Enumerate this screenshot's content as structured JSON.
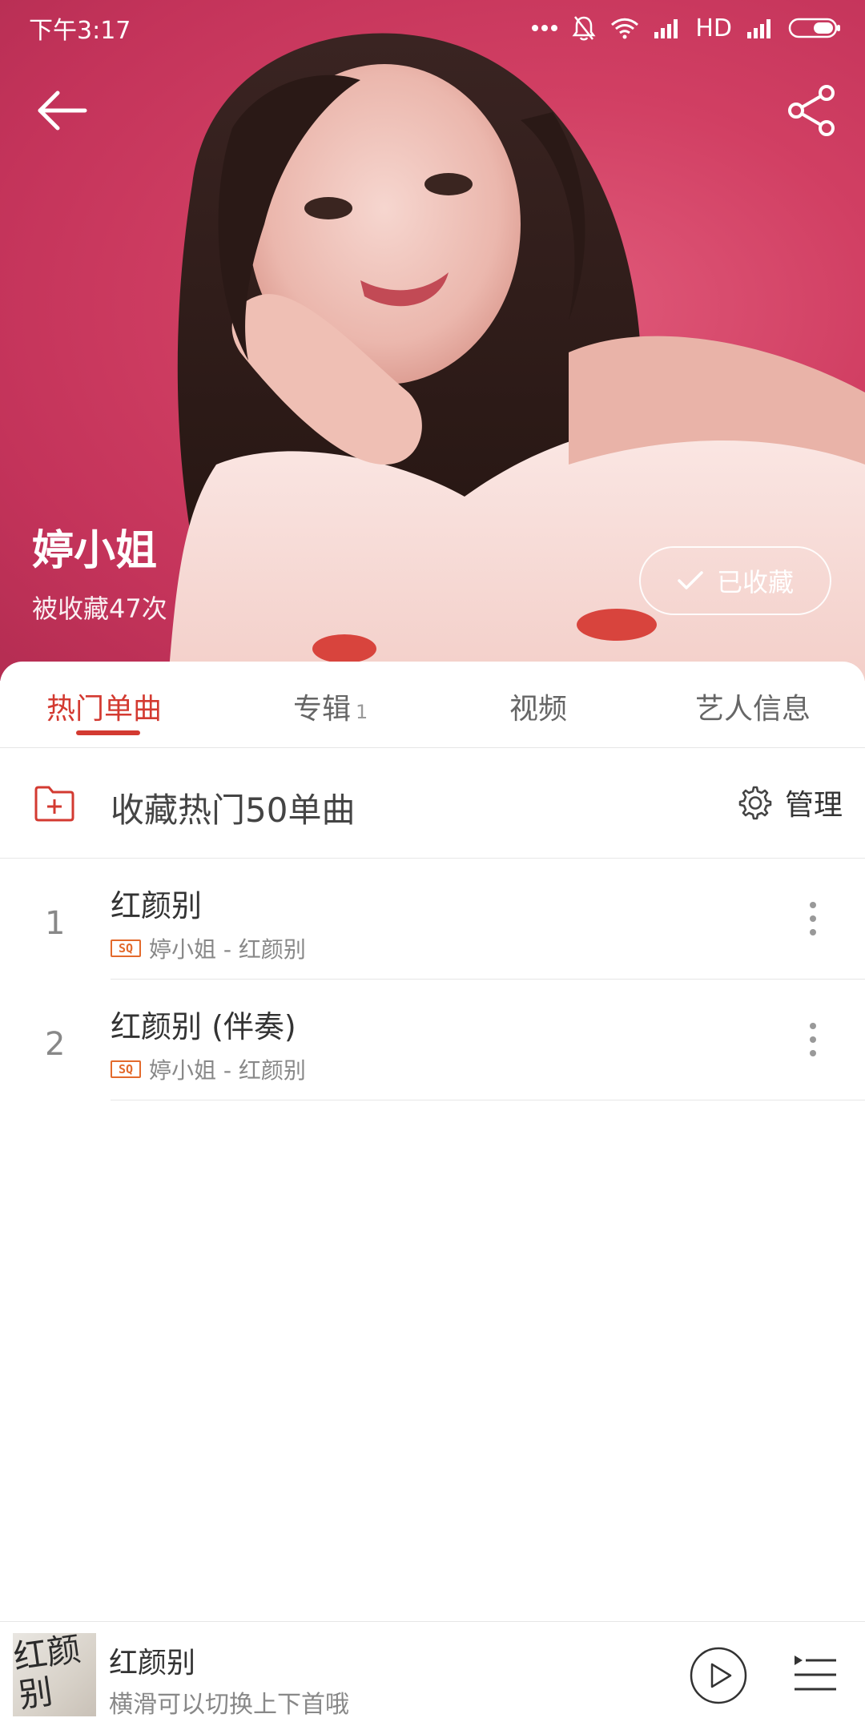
{
  "status_bar": {
    "time": "下午3:17",
    "network": "HD"
  },
  "header": {
    "back_icon": "back-arrow-icon",
    "share_icon": "share-icon"
  },
  "artist": {
    "name": "婷小姐",
    "favorited_count": "被收藏47次",
    "favorite_button": "已收藏"
  },
  "tabs": [
    {
      "label": "热门单曲",
      "count": ""
    },
    {
      "label": "专辑",
      "count": "1"
    },
    {
      "label": "视频",
      "count": ""
    },
    {
      "label": "艺人信息",
      "count": ""
    }
  ],
  "collect_row": {
    "label": "收藏热门50单曲",
    "manage_label": "管理"
  },
  "songs": [
    {
      "index": "1",
      "title": "红颜别",
      "quality_badge": "SQ",
      "subtitle": "婷小姐 - 红颜别"
    },
    {
      "index": "2",
      "title": "红颜别 (伴奏)",
      "quality_badge": "SQ",
      "subtitle": "婷小姐 - 红颜别"
    }
  ],
  "player": {
    "title": "红颜别",
    "subtitle": "横滑可以切换上下首哦",
    "cover_text": "红颜别"
  },
  "colors": {
    "accent": "#d33a31",
    "hero_background": "#c83a5f"
  }
}
